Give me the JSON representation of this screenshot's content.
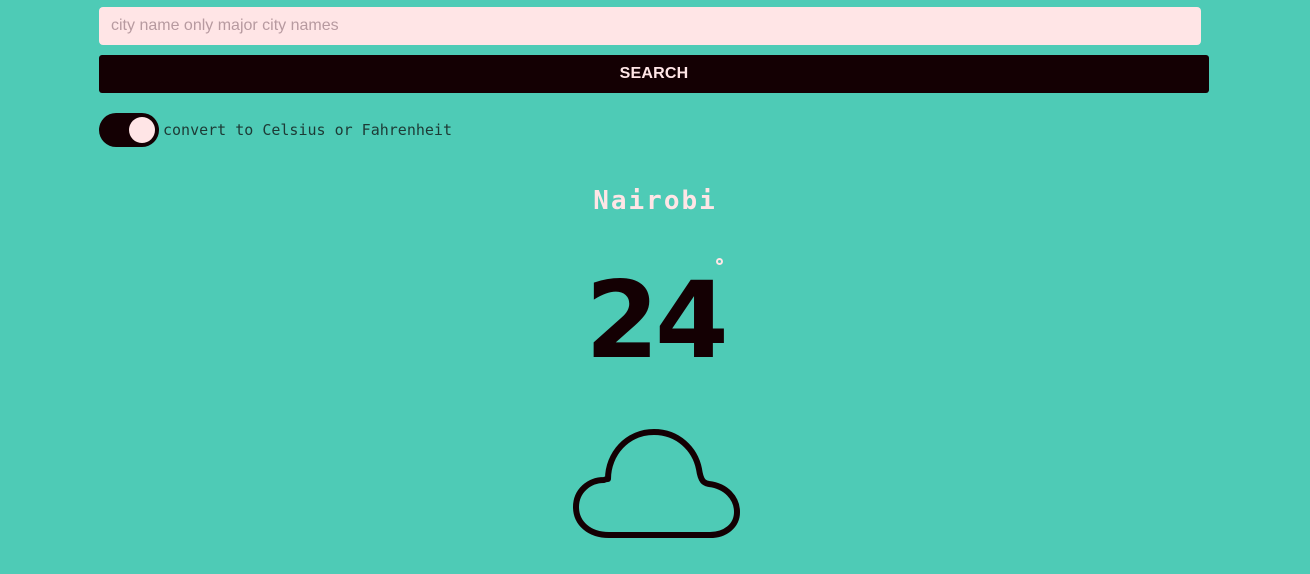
{
  "search": {
    "placeholder": "city name only major city names",
    "value": "",
    "button_label": "SEARCH"
  },
  "units_toggle": {
    "label": "convert to Celsius or Fahrenheit",
    "state": "on"
  },
  "weather": {
    "city": "Nairobi",
    "temperature": "24",
    "condition_icon": "cloud-icon"
  },
  "colors": {
    "background": "#4ecbb6",
    "accent_dark": "#140003",
    "accent_light": "#ffe5e6"
  }
}
